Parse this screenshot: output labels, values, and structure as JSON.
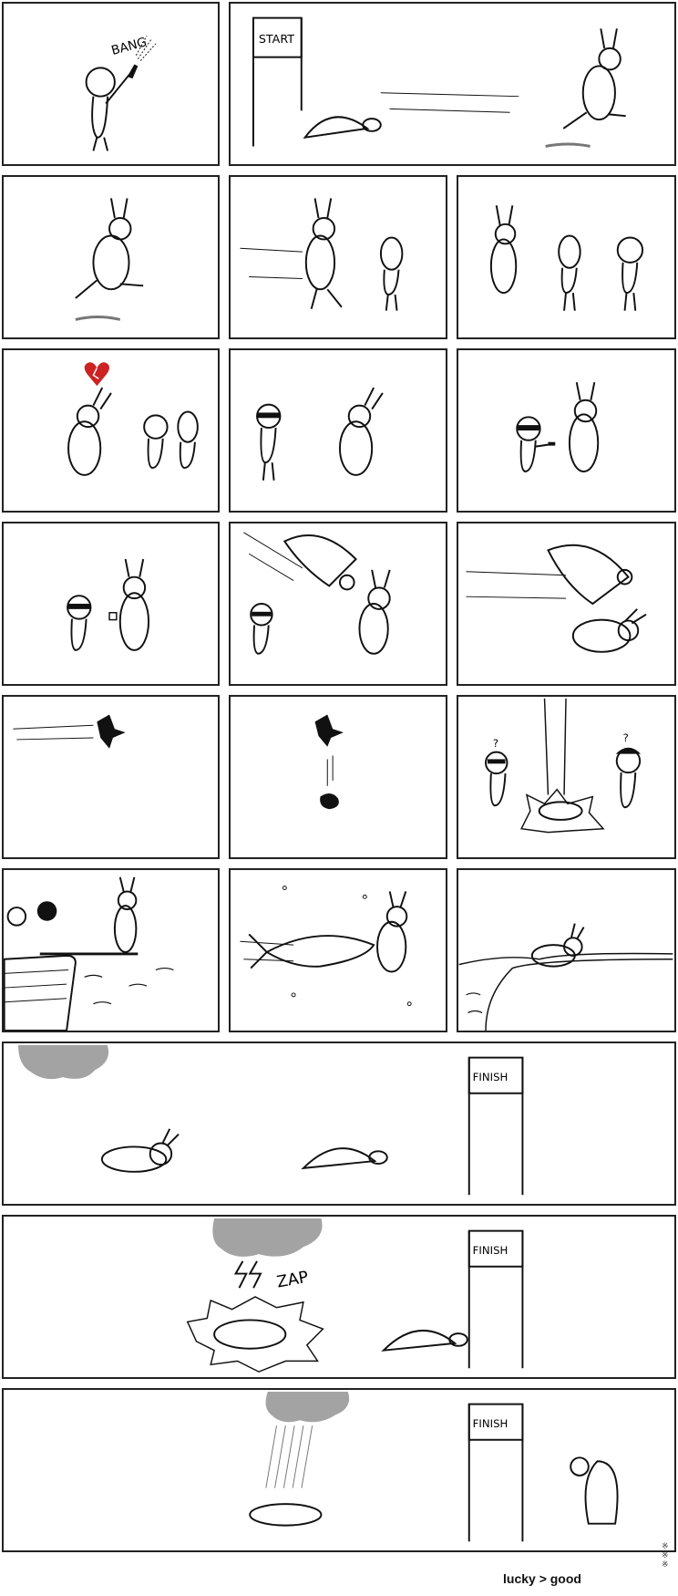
{
  "comic": {
    "caption": "lucky > good",
    "sound_bang": "BANG",
    "sign_start": "START",
    "sign_finish": "FINISH",
    "sound_zap": "ZAP",
    "question_mark": "?"
  },
  "colors": {
    "ink": "#111111",
    "heart": "#cc2222",
    "cloud": "#666666"
  }
}
